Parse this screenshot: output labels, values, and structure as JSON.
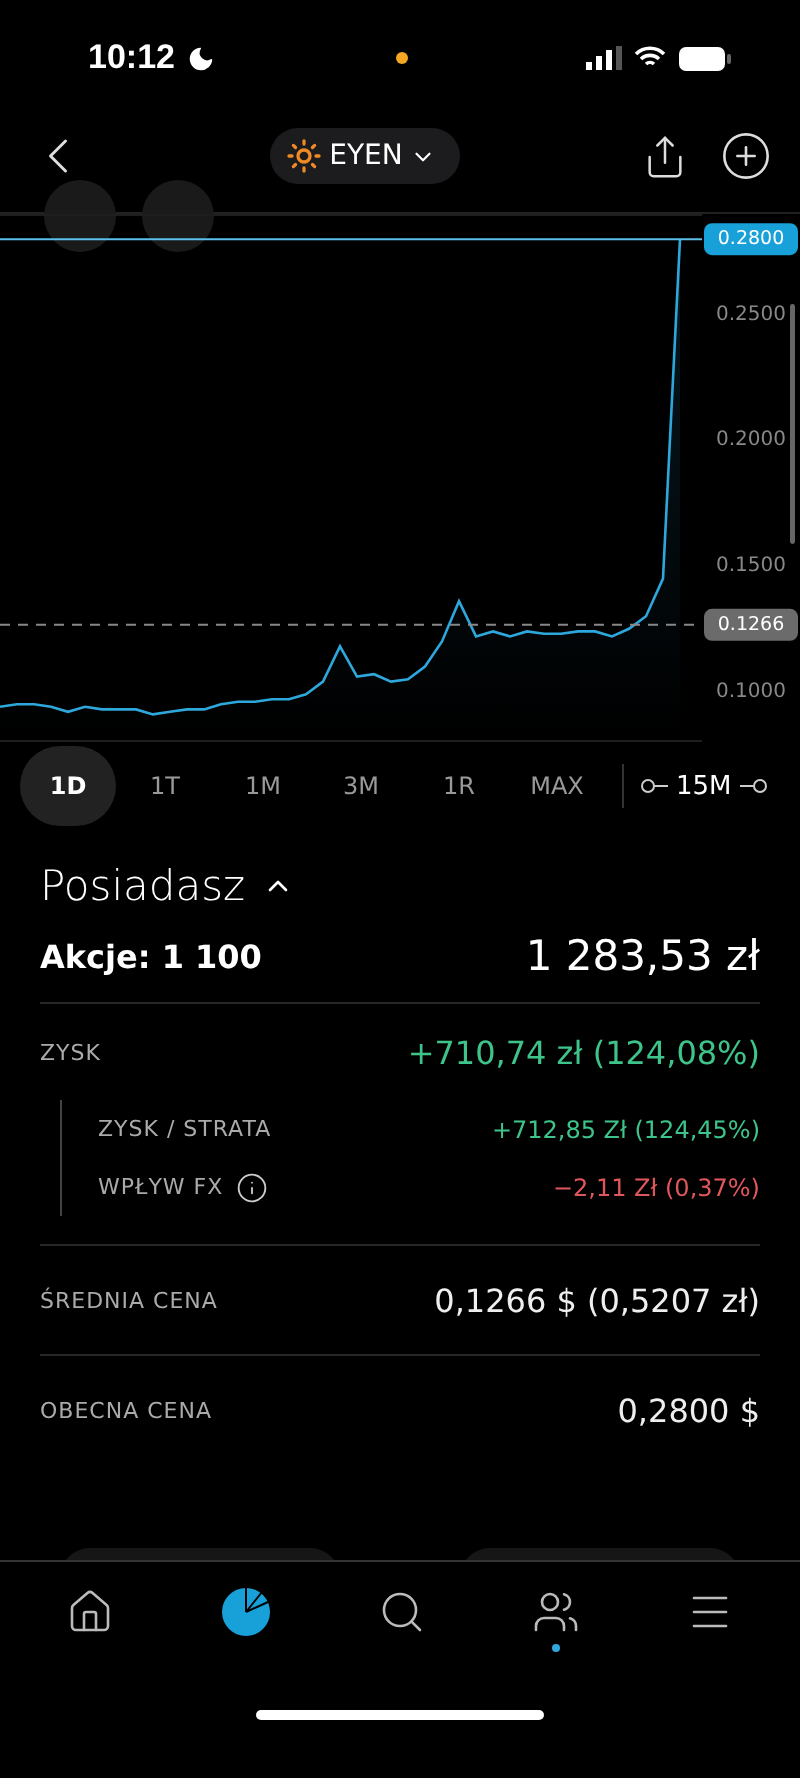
{
  "status_bar": {
    "time": "10:12"
  },
  "header": {
    "ticker": "EYEN"
  },
  "chart_data": {
    "type": "area",
    "ylim": [
      0.08,
      0.29
    ],
    "yticks": [
      {
        "value": 0.1,
        "label": "0.1000"
      },
      {
        "value": 0.15,
        "label": "0.1500"
      },
      {
        "value": 0.2,
        "label": "0.2000"
      },
      {
        "value": 0.25,
        "label": "0.2500"
      }
    ],
    "series": [
      {
        "color": "#2ea8dc",
        "values": [
          0.094,
          0.095,
          0.095,
          0.094,
          0.092,
          0.094,
          0.093,
          0.093,
          0.093,
          0.091,
          0.092,
          0.093,
          0.093,
          0.095,
          0.096,
          0.096,
          0.097,
          0.097,
          0.099,
          0.104,
          0.118,
          0.106,
          0.107,
          0.104,
          0.105,
          0.11,
          0.12,
          0.136,
          0.122,
          0.124,
          0.122,
          0.124,
          0.123,
          0.123,
          0.124,
          0.124,
          0.122,
          0.125,
          0.13,
          0.145,
          0.28
        ]
      }
    ],
    "ref_lines": [
      {
        "axis": "y",
        "value": 0.28,
        "label": "0.2800"
      },
      {
        "axis": "y",
        "value": 0.1266,
        "label": "0.1266"
      }
    ]
  },
  "ranges": [
    {
      "label": "1D",
      "selected": true
    },
    {
      "label": "1T",
      "selected": false
    },
    {
      "label": "1M",
      "selected": false
    },
    {
      "label": "3M",
      "selected": false
    },
    {
      "label": "1R",
      "selected": false
    },
    {
      "label": "MAX",
      "selected": false
    }
  ],
  "interval": "15M",
  "holdings": {
    "title": "Posiadasz",
    "expanded": true,
    "shares": "Akcje: 1 100",
    "value": "1 283,53 zł",
    "profit": {
      "label": "ZYSK",
      "value": "+710,74 zł (124,08%)",
      "children": [
        {
          "label": "ZYSK / STRATA",
          "value": "+712,85 Zł (124,45%)",
          "color": "#3ec48a",
          "info": false
        },
        {
          "label": "WPŁYW FX",
          "value": "−2,11 Zł (0,37%)",
          "color": "#e0575b",
          "info": true
        }
      ]
    },
    "rows": [
      {
        "label": "ŚREDNIA CENA",
        "value": "0,1266 $ (0,5207 zł)"
      },
      {
        "label": "OBECNA CENA",
        "value": "0,2800 $"
      }
    ]
  },
  "nav": [
    {
      "kind": "home",
      "selected": false,
      "dot": false
    },
    {
      "kind": "portfolio",
      "selected": true,
      "dot": false
    },
    {
      "kind": "search",
      "selected": false,
      "dot": false
    },
    {
      "kind": "people",
      "selected": false,
      "dot": true
    },
    {
      "kind": "menu",
      "selected": false,
      "dot": false
    }
  ]
}
